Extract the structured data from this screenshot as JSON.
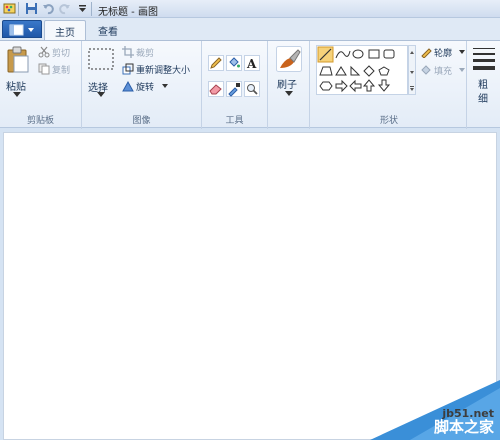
{
  "window": {
    "title": "无标题 - 画图"
  },
  "tabs": [
    {
      "label": "主页"
    },
    {
      "label": "查看"
    }
  ],
  "clipboard": {
    "paste": "粘贴",
    "cut": "剪切",
    "copy": "复制",
    "group": "剪贴板"
  },
  "image": {
    "select": "选择",
    "crop": "裁剪",
    "resize": "重新调整大小",
    "rotate": "旋转",
    "group": "图像"
  },
  "tools": {
    "group": "工具"
  },
  "brushes": {
    "label": "刷子"
  },
  "shapes": {
    "outline": "轮廓",
    "fill": "填充",
    "group": "形状"
  },
  "size": {
    "label_top": "粗",
    "label_bottom": "细"
  },
  "watermark": {
    "site": "jb51.net",
    "cn": "脚本之家"
  },
  "colors": {
    "accent": "#1f57a8",
    "canvas": "#ffffff",
    "workspace": "#d5e3f3"
  }
}
